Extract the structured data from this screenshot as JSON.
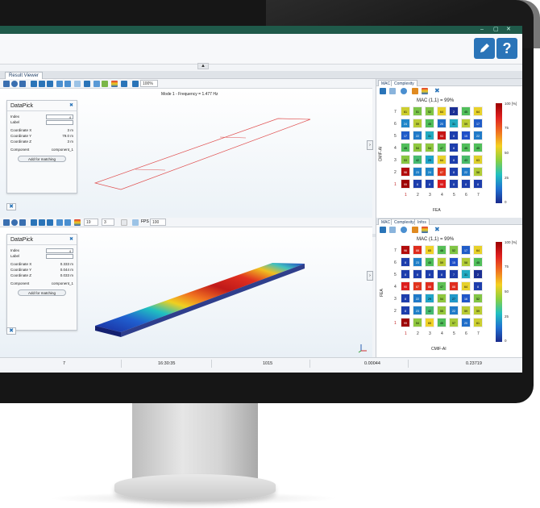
{
  "window": {
    "min": "–",
    "max": "▢",
    "close": "✕"
  },
  "ribbon": {
    "edit_icon": "pencil-icon",
    "help_label": "?"
  },
  "tabs": {
    "result_viewer": "Result Viewer"
  },
  "top": {
    "mode_title": "Mode 1 - Frequency = 1.477 Hz",
    "toolbar_zoom": "100%",
    "datapick": {
      "title": "DataPick",
      "index_label": "Index",
      "index_value": "4",
      "label_label": "Label",
      "label_value": "",
      "coord_x_label": "Coordinate X",
      "coord_x": "3 m",
      "coord_y_label": "Coordinate Y",
      "coord_y": "79.0 m",
      "coord_z_label": "Coordinate Z",
      "coord_z": "3 m",
      "component_label": "Component",
      "component": "component_1",
      "add_button": "Add for matching"
    }
  },
  "bottom": {
    "toolbar_val1": "19",
    "toolbar_val2": "3",
    "toolbar_fps_label": "FPS",
    "toolbar_fps": "100",
    "datapick": {
      "title": "DataPick",
      "index_label": "Index",
      "index_value": "4",
      "label_label": "Label",
      "label_value": "",
      "coord_x_label": "Coordinate X",
      "coord_x": "0.333 m",
      "coord_y_label": "Coordinate Y",
      "coord_y": "0.044 m",
      "coord_z_label": "Coordinate Z",
      "coord_z": "0.033 m",
      "component_label": "Component",
      "component": "component_1",
      "add_button": "Add for matching"
    }
  },
  "right_top": {
    "tabs": [
      "MAC",
      "Complexity"
    ],
    "title": "MAC (1,1) = 99%",
    "ylabel": "CMIF-AI",
    "xlabel": "FEA",
    "colorbar_ticks": [
      "100 [%]",
      "75",
      "50",
      "25",
      "0"
    ]
  },
  "right_bottom": {
    "tabs": [
      "MAC",
      "Complexity",
      "Infos"
    ],
    "title": "MAC (1,1) = 99%",
    "ylabel": "FEA",
    "xlabel": "CMIF-AI",
    "colorbar_ticks": [
      "100 [%]",
      "75",
      "50",
      "25",
      "0"
    ]
  },
  "chart_data": [
    {
      "type": "heatmap",
      "title": "MAC (1,1) = 99%",
      "xlabel": "FEA",
      "ylabel": "CMIF-AI",
      "x": [
        1,
        2,
        3,
        4,
        5,
        6,
        7
      ],
      "y": [
        7,
        6,
        5,
        4,
        3,
        2,
        1
      ],
      "values": [
        [
          61,
          51,
          52,
          64,
          2,
          45,
          64
        ],
        [
          24,
          59,
          45,
          20,
          31,
          59,
          17
        ],
        [
          17,
          22,
          31,
          93,
          8,
          15,
          22
        ],
        [
          45,
          54,
          54,
          47,
          8,
          45,
          45
        ],
        [
          53,
          42,
          29,
          64,
          8,
          43,
          63
        ],
        [
          96,
          23,
          24,
          87,
          8,
          22,
          58
        ],
        [
          99,
          8,
          8,
          90,
          8,
          8,
          8
        ]
      ],
      "vmin": 0,
      "vmax": 100
    },
    {
      "type": "heatmap",
      "title": "MAC (1,1) = 99%",
      "xlabel": "CMIF-AI",
      "ylabel": "FEA",
      "x": [
        1,
        2,
        3,
        4,
        5,
        6,
        7
      ],
      "y": [
        7,
        6,
        5,
        4,
        3,
        2,
        1
      ],
      "values": [
        [
          96,
          88,
          65,
          46,
          52,
          17,
          64
        ],
        [
          8,
          23,
          45,
          59,
          15,
          58,
          45
        ],
        [
          8,
          8,
          8,
          8,
          7,
          31,
          2
        ],
        [
          90,
          87,
          88,
          47,
          88,
          64,
          8
        ],
        [
          8,
          22,
          29,
          54,
          27,
          16,
          52
        ],
        [
          8,
          23,
          42,
          55,
          22,
          59,
          59
        ],
        [
          99,
          54,
          65,
          45,
          57,
          20,
          61
        ]
      ],
      "vmin": 0,
      "vmax": 100
    }
  ],
  "statusbar": {
    "v1": "7",
    "time": "16:30:35",
    "v3": "1015",
    "v4": "0.00044",
    "v5": "0.23719"
  }
}
